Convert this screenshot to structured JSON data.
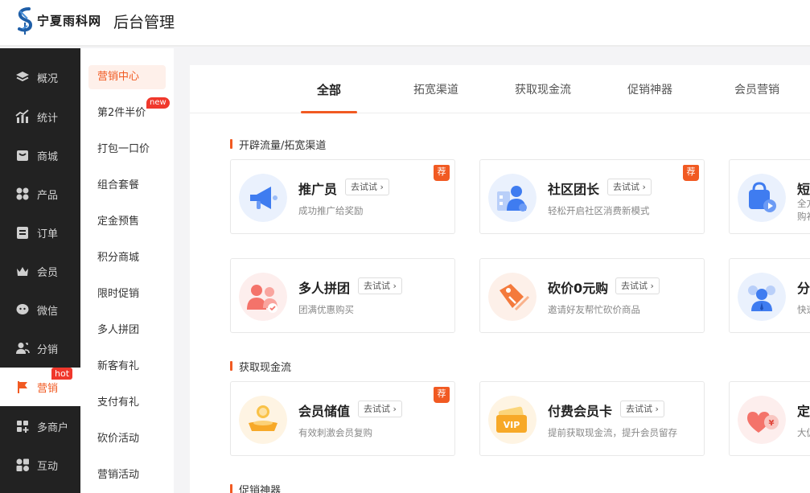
{
  "header": {
    "brand": "宁夏雨科网",
    "system_title": "后台管理"
  },
  "sidebar": {
    "items": [
      {
        "label": "概况",
        "icon": "layers-icon"
      },
      {
        "label": "统计",
        "icon": "chart-icon"
      },
      {
        "label": "商城",
        "icon": "store-icon"
      },
      {
        "label": "产品",
        "icon": "grid-icon"
      },
      {
        "label": "订单",
        "icon": "clipboard-icon"
      },
      {
        "label": "会员",
        "icon": "crown-icon"
      },
      {
        "label": "微信",
        "icon": "wechat-icon"
      },
      {
        "label": "分销",
        "icon": "users-icon"
      },
      {
        "label": "营销",
        "icon": "flag-icon",
        "badge": "hot",
        "active": true
      },
      {
        "label": "多商户",
        "icon": "plus-square-icon"
      },
      {
        "label": "互动",
        "icon": "apps-icon"
      }
    ]
  },
  "submenu": {
    "items": [
      {
        "label": "营销中心",
        "active": true
      },
      {
        "label": "第2件半价",
        "badge": "new"
      },
      {
        "label": "打包一口价"
      },
      {
        "label": "组合套餐"
      },
      {
        "label": "定金预售"
      },
      {
        "label": "积分商城"
      },
      {
        "label": "限时促销"
      },
      {
        "label": "多人拼团"
      },
      {
        "label": "新客有礼"
      },
      {
        "label": "支付有礼"
      },
      {
        "label": "砍价活动"
      },
      {
        "label": "营销活动"
      }
    ]
  },
  "tabs": [
    {
      "label": "全部",
      "active": true
    },
    {
      "label": "拓宽渠道"
    },
    {
      "label": "获取现金流"
    },
    {
      "label": "促销神器"
    },
    {
      "label": "会员营销"
    }
  ],
  "sections": [
    {
      "title": "开辟流量/拓宽渠道",
      "cards": [
        {
          "title": "推广员",
          "desc": "成功推广给奖励",
          "try": "去试试",
          "rec": "荐"
        },
        {
          "title": "社区团长",
          "desc": "轻松开启社区消费新模式",
          "try": "去试试",
          "rec": "荐"
        },
        {
          "title": "短",
          "desc": "全方",
          "desc2": "购补"
        },
        {
          "title": "多人拼团",
          "desc": "团满优惠购买",
          "try": "去试试"
        },
        {
          "title": "砍价0元购",
          "desc": "邀请好友帮忙砍价商品",
          "try": "去试试"
        },
        {
          "title": "分",
          "desc": "快速"
        }
      ]
    },
    {
      "title": "获取现金流",
      "cards": [
        {
          "title": "会员储值",
          "desc": "有效刺激会员复购",
          "try": "去试试",
          "rec": "荐"
        },
        {
          "title": "付费会员卡",
          "desc": "提前获取现金流，提升会员留存",
          "try": "去试试"
        },
        {
          "title": "定",
          "desc": "大促"
        }
      ]
    },
    {
      "title": "促销神器"
    }
  ],
  "icon_texts": {
    "vip": "VIP",
    "yen": "¥"
  },
  "colors": {
    "accent": "#f15a22",
    "sidebar_bg": "#222222",
    "badge_red": "#f0382c"
  }
}
